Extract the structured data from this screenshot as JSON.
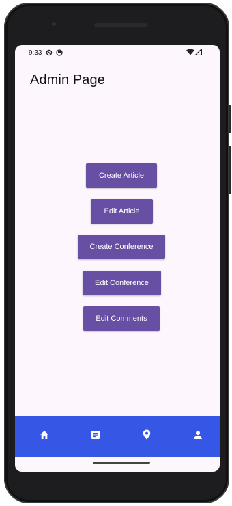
{
  "status": {
    "time": "9:33"
  },
  "page": {
    "title": "Admin Page"
  },
  "buttons": {
    "create_article": "Create Article",
    "edit_article": "Edit Article",
    "create_conference": "Create Conference",
    "edit_conference": "Edit Conference",
    "edit_comments": "Edit Comments"
  },
  "nav": {
    "items": [
      "home-icon",
      "article-icon",
      "location-pin-icon",
      "person-icon"
    ]
  },
  "colors": {
    "button": "#6750a4",
    "navbar": "#3657e5",
    "screen_bg": "#fdf7fd"
  }
}
